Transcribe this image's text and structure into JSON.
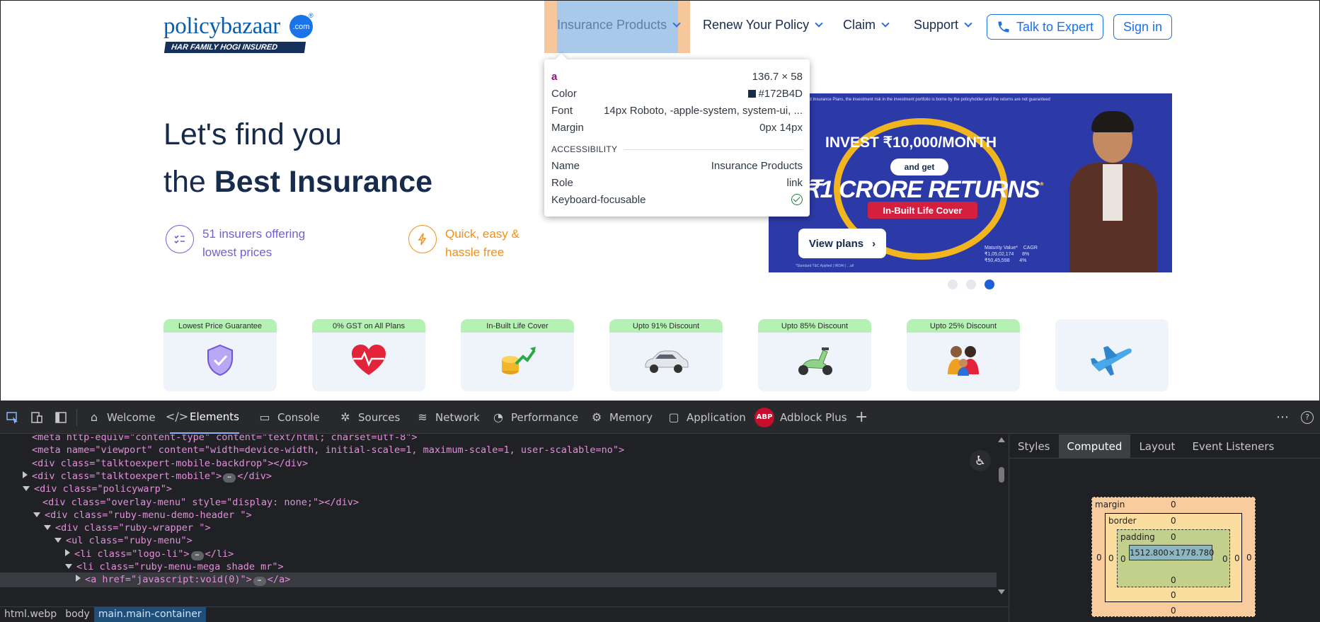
{
  "site": {
    "logo": {
      "name": "policybazaar",
      "com": ".com",
      "reg": "®",
      "tagline": "HAR FAMILY HOGI INSURED"
    },
    "nav": [
      {
        "label": "Insurance Products"
      },
      {
        "label": "Renew Your Policy"
      },
      {
        "label": "Claim"
      },
      {
        "label": "Support"
      }
    ],
    "talk_button": "Talk to Expert",
    "signin_button": "Sign in",
    "hero": {
      "line1": "Let's find you",
      "line2_pre": "the ",
      "line2_bold": "Best Insurance"
    },
    "features": [
      {
        "line1": "51 insurers offering",
        "line2": "lowest prices",
        "icon": "list-check-icon",
        "color": "#6e61d9"
      },
      {
        "line1": "Quick, easy &",
        "line2": "hassle free",
        "icon": "bolt-icon",
        "color": "#f58f14"
      }
    ],
    "banner": {
      "top_note": "ed Insurance Plans, the investment risk in the investment portfolio is borne by the policyholder and the returns are not guaranteed",
      "headline1": "INVEST ₹10,000/MONTH",
      "pill": "and get",
      "headline2": "₹1 CRORE RETURNS",
      "asterisk": "*",
      "tag": "In-Built Life Cover",
      "button": "View plans",
      "maturity_label": "Maturity Value*",
      "cagr_label": "CAGR",
      "maturity_values": [
        "₹1,05,02,174",
        "₹50,45,598"
      ],
      "cagr_values": [
        "8%",
        "4%"
      ],
      "footnote": "*Standard T&C Applied | IRDAI | ...all"
    },
    "carousel": {
      "count": 3,
      "active": 3
    },
    "cards": [
      {
        "label": "Lowest Price Guarantee",
        "icon": "shield-check-icon",
        "glyph": "🛡"
      },
      {
        "label": "0% GST on All Plans",
        "icon": "heart-pulse-icon",
        "glyph": "❤"
      },
      {
        "label": "In-Built Life Cover",
        "icon": "coins-growth-icon",
        "glyph": "💰"
      },
      {
        "label": "Upto 91% Discount",
        "icon": "car-icon",
        "glyph": "🚗"
      },
      {
        "label": "Upto 85% Discount",
        "icon": "scooter-icon",
        "glyph": "🛵"
      },
      {
        "label": "Upto 25% Discount",
        "icon": "family-icon",
        "glyph": "👪"
      },
      {
        "label": "",
        "icon": "airplane-icon",
        "glyph": "✈"
      }
    ]
  },
  "tooltip": {
    "tag": "a",
    "size": "136.7 × 58",
    "color_label": "Color",
    "color_value": "#172B4D",
    "font_label": "Font",
    "font_value": "14px Roboto, -apple-system, system-ui, ...",
    "margin_label": "Margin",
    "margin_value": "0px 14px",
    "accessibility": "ACCESSIBILITY",
    "name_label": "Name",
    "name_value": "Insurance Products",
    "role_label": "Role",
    "role_value": "link",
    "focus_label": "Keyboard-focusable"
  },
  "devtools": {
    "tabs": [
      "Welcome",
      "Elements",
      "Console",
      "Sources",
      "Network",
      "Performance",
      "Memory",
      "Application",
      "Adblock Plus"
    ],
    "active_tab": "Elements",
    "abp_badge": "ABP",
    "code_lines": [
      {
        "indent": 2,
        "html": "<meta http-equiv=\"content-type\" content=\"text/html; charset=utf-8\">",
        "partial": true
      },
      {
        "indent": 2,
        "html": "<meta name=\"viewport\" content=\"width=device-width, initial-scale=1, maximum-scale=1, user-scalable=no\">"
      },
      {
        "indent": 2,
        "html": "<div class=\"talktoexpert-mobile-backdrop\"></div>"
      },
      {
        "indent": 2,
        "arrow": "r",
        "html": "<div class=\"talktoexpert-mobile\">",
        "ellipsis": true,
        "close": "</div>"
      },
      {
        "indent": 2,
        "arrow": "d",
        "html": "<div class=\"policywarp\">"
      },
      {
        "indent": 3,
        "html": "<div class=\"overlay-menu\" style=\"display: none;\"></div>"
      },
      {
        "indent": 3,
        "arrow": "d",
        "html": "<div class=\"ruby-menu-demo-header \">"
      },
      {
        "indent": 4,
        "arrow": "d",
        "html": "<div class=\"ruby-wrapper \">"
      },
      {
        "indent": 5,
        "arrow": "d",
        "html": "<ul class=\"ruby-menu\">"
      },
      {
        "indent": 6,
        "arrow": "r",
        "html": "<li class=\"logo-li\">",
        "ellipsis": true,
        "close": "</li>"
      },
      {
        "indent": 6,
        "arrow": "d",
        "html": "<li class=\"ruby-menu-mega shade mr\">"
      },
      {
        "indent": 7,
        "arrow": "r",
        "html": "<a href=\"javascript:void(0)\">",
        "ellipsis": true,
        "close": "</a>",
        "selected": true
      }
    ],
    "breadcrumbs": [
      "html.webp",
      "body",
      "main.main-container"
    ],
    "side_tabs": [
      "Styles",
      "Computed",
      "Layout",
      "Event Listeners"
    ],
    "active_side_tab": "Computed",
    "box_model": {
      "margin_label": "margin",
      "border_label": "border",
      "padding_label": "padding",
      "margin": "0",
      "border": "0",
      "padding": "0",
      "content": "1512.800×1778.780"
    }
  }
}
